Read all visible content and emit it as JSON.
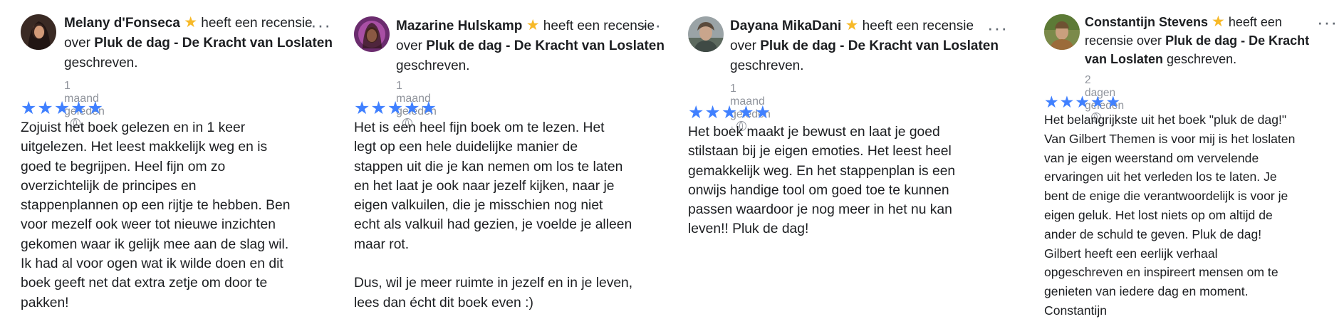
{
  "reviews": [
    {
      "reviewer": "Melany d'Fonseca",
      "text_before": " heeft een recensie over ",
      "book": "Pluk de dag - De Kracht van Loslaten",
      "text_after": " geschreven.",
      "time": "1 maand geleden",
      "more": "···",
      "stars": "★★★★★",
      "body": "Zojuist het boek gelezen en in 1 keer\nuitgelezen. Het leest makkelijk weg en is\ngoed te begrijpen. Heel fijn om zo\noverzichtelijk de principes en\nstappenplannen op een rijtje te hebben. Ben\nvoor mezelf ook weer tot nieuwe inzichten\ngekomen waar ik gelijk mee aan de slag wil.\nIk had al voor ogen wat ik wilde doen en dit\nboek geeft net dat extra zetje om door te\npakken!"
    },
    {
      "reviewer": "Mazarine Hulskamp",
      "text_before": " heeft een recensie over ",
      "book": "Pluk de dag - De Kracht van Loslaten",
      "text_after": " geschreven.",
      "time": "1 maand geleden",
      "more": "···",
      "stars": "★★★★★",
      "body": "Het is een heel fijn boek om te lezen. Het\nlegt op een hele duidelijke manier de\nstappen uit die je kan nemen om los te laten\nen het laat je ook naar jezelf kijken, naar je\neigen valkuilen, die je misschien nog niet\necht als valkuil had gezien, je voelde je alleen\nmaar rot.\n\nDus, wil je meer ruimte in jezelf en in je leven,\nlees dan écht dit boek even :)"
    },
    {
      "reviewer": "Dayana MikaDani",
      "text_before": " heeft een recensie over ",
      "book": "Pluk de dag - De Kracht van Loslaten",
      "text_after": " geschreven.",
      "time": "1 maand geleden",
      "more": "···",
      "stars": "★★★★★",
      "body": "Het boek maakt je bewust en laat je goed\nstilstaan bij je eigen emoties. Het leest heel\ngemakkelijk weg. En het stappenplan is een\nonwijs handige tool om goed toe te kunnen\npassen waardoor je nog meer in het nu kan\nleven!! Pluk de dag!"
    },
    {
      "reviewer": "Constantijn Stevens",
      "text_before": " heeft een recensie over ",
      "book": "Pluk de dag - De Kracht van Loslaten",
      "text_after": " geschreven.",
      "time": "2 dagen geleden",
      "more": "···",
      "stars": "★★★★★",
      "body": "Het belangrijkste uit het boek \"pluk de dag!\"\nVan Gilbert Themen is voor mij is het loslaten\nvan je eigen weerstand om vervelende\nervaringen uit het verleden los te laten. Je\nbent de enige die verantwoordelijk is voor je\neigen geluk. Het lost niets op om altijd de\nander de schuld te geven. Pluk de dag!\nGilbert heeft een eerlijk verhaal\nopgeschreven en inspireert mensen om te\ngenieten van iedere dag en moment.\nConstantijn"
    }
  ],
  "colors": {
    "rating_star": "#4080ff",
    "badge_star": "#f7b928",
    "meta_text": "#90949c"
  }
}
